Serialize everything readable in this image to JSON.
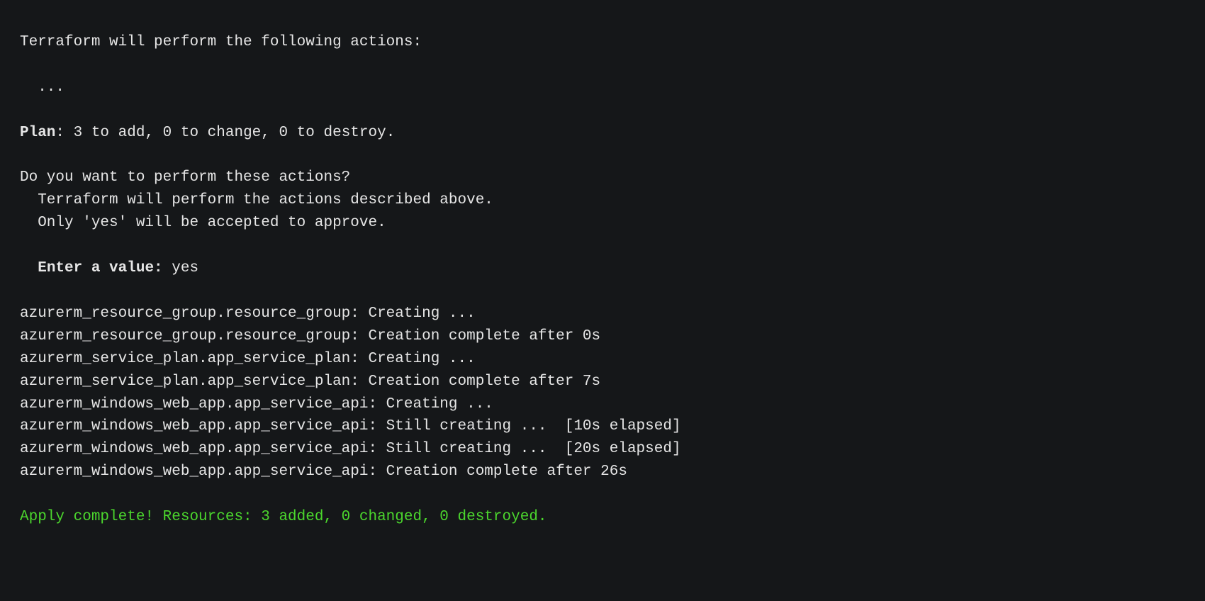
{
  "intro": "Terraform will perform the following actions:",
  "ellipsis": "  ...",
  "plan_label": "Plan",
  "plan_rest": ": 3 to add, 0 to change, 0 to destroy.",
  "confirm_q": "Do you want to perform these actions?",
  "confirm_l1": "  Terraform will perform the actions described above.",
  "confirm_l2": "  Only 'yes' will be accepted to approve.",
  "enter_indent": "  ",
  "enter_label": "Enter a value:",
  "enter_value": " yes",
  "log": [
    "azurerm_resource_group.resource_group: Creating ...",
    "azurerm_resource_group.resource_group: Creation complete after 0s",
    "azurerm_service_plan.app_service_plan: Creating ...",
    "azurerm_service_plan.app_service_plan: Creation complete after 7s",
    "azurerm_windows_web_app.app_service_api: Creating ...",
    "azurerm_windows_web_app.app_service_api: Still creating ...  [10s elapsed]",
    "azurerm_windows_web_app.app_service_api: Still creating ...  [20s elapsed]",
    "azurerm_windows_web_app.app_service_api: Creation complete after 26s"
  ],
  "apply_complete": "Apply complete! Resources: 3 added, 0 changed, 0 destroyed."
}
